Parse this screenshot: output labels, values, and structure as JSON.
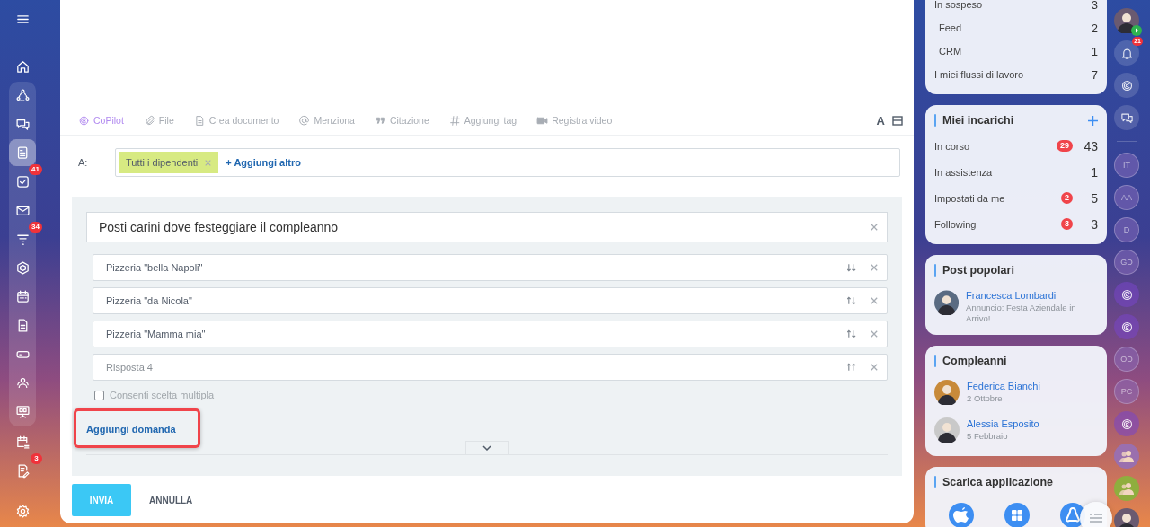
{
  "nav": {
    "items": [
      {
        "kind": "home",
        "grouped": false,
        "selected": false
      },
      {
        "kind": "network",
        "grouped": true,
        "selected": false
      },
      {
        "kind": "chat",
        "grouped": true,
        "selected": false
      },
      {
        "kind": "feed",
        "grouped": true,
        "selected": true
      },
      {
        "kind": "tasks",
        "grouped": true,
        "selected": false,
        "badge": "41"
      },
      {
        "kind": "mail",
        "grouped": true,
        "selected": false
      },
      {
        "kind": "funnel",
        "grouped": true,
        "selected": false,
        "badge": "34"
      },
      {
        "kind": "hexagon",
        "grouped": true,
        "selected": false
      },
      {
        "kind": "calendar",
        "grouped": true,
        "selected": false
      },
      {
        "kind": "document",
        "grouped": true,
        "selected": false
      },
      {
        "kind": "drive",
        "grouped": true,
        "selected": false
      },
      {
        "kind": "people",
        "grouped": true,
        "selected": false
      },
      {
        "kind": "presentation",
        "grouped": true,
        "selected": false
      },
      {
        "kind": "schedule",
        "grouped": false,
        "selected": false
      },
      {
        "kind": "edit",
        "grouped": false,
        "selected": false,
        "badge": "3"
      },
      {
        "kind": "settings",
        "grouped": false,
        "selected": false
      }
    ]
  },
  "composer": {
    "toolbar": [
      {
        "kind": "copilot",
        "label": "CoPilot",
        "accent": true
      },
      {
        "kind": "file",
        "label": "File",
        "accent": false
      },
      {
        "kind": "document",
        "label": "Crea documento",
        "accent": false
      },
      {
        "kind": "mention",
        "label": "Menziona",
        "accent": false
      },
      {
        "kind": "quote",
        "label": "Citazione",
        "accent": false
      },
      {
        "kind": "tag",
        "label": "Aggiungi tag",
        "accent": false
      },
      {
        "kind": "video",
        "label": "Registra video",
        "accent": false
      }
    ],
    "format_label": "A",
    "recipients": {
      "label": "A:",
      "tags": [
        {
          "label": "Tutti i dipendenti"
        }
      ],
      "add_link": "+ Aggiungi altro"
    },
    "poll": {
      "question": "Posti carini dove festeggiare il compleanno",
      "answers": [
        {
          "value": "Pizzeria \"bella Napoli\"",
          "kind": "down"
        },
        {
          "value": "Pizzeria \"da Nicola\"",
          "kind": "both"
        },
        {
          "value": "Pizzeria \"Mamma mia\"",
          "kind": "both"
        },
        {
          "placeholder": "Risposta  4",
          "kind": "up"
        }
      ],
      "multiple_choice": {
        "label": "Consenti scelta multipla",
        "checked": false
      },
      "add_question": {
        "label": "Aggiungi domanda",
        "highlighted": true
      }
    },
    "buttons": [
      {
        "label": "INVIA",
        "kind": "primary"
      },
      {
        "label": "ANNULLA",
        "kind": "plain"
      }
    ]
  },
  "right_panel": {
    "workflows": {
      "rows": [
        {
          "label": "In sospeso",
          "count": "3",
          "children": [
            {
              "label": "Feed",
              "count": "2"
            },
            {
              "label": "CRM",
              "count": "1"
            }
          ]
        },
        {
          "label": "I miei flussi di lavoro",
          "count": "7"
        }
      ]
    },
    "tasks": {
      "title": "Miei incarichi",
      "rows": [
        {
          "label": "In corso",
          "badge": "29",
          "count": "43"
        },
        {
          "label": "In assistenza",
          "count": "1"
        },
        {
          "label": "Impostati da me",
          "badge": "2",
          "count": "5"
        },
        {
          "label": "Following",
          "badge": "3",
          "count": "3"
        }
      ]
    },
    "popular": {
      "title": "Post popolari",
      "posts": [
        {
          "author": "Francesca Lombardi",
          "text": "Annuncio: Festa Aziendale in Arrivo!"
        }
      ]
    },
    "birthdays": {
      "title": "Compleanni",
      "people": [
        {
          "name": "Federica Bianchi",
          "date": "2 Ottobre"
        },
        {
          "name": "Alessia Esposito",
          "date": "5 Febbraio"
        }
      ]
    },
    "apps": {
      "title": "Scarica applicazione",
      "platforms": [
        {
          "kind": "apple"
        },
        {
          "kind": "windows"
        },
        {
          "kind": "linux"
        }
      ]
    }
  },
  "right_rail": {
    "items": [
      {
        "kind": "avatar"
      },
      {
        "kind": "bell",
        "badge": "21"
      },
      {
        "kind": "copilot"
      },
      {
        "kind": "chat"
      },
      {
        "kind": "divider"
      },
      {
        "kind": "initials",
        "text": "IT"
      },
      {
        "kind": "initials",
        "text": "AA"
      },
      {
        "kind": "initials",
        "text": "D"
      },
      {
        "kind": "initials",
        "text": "GD"
      },
      {
        "kind": "copilot-chat"
      },
      {
        "kind": "copilot-chat"
      },
      {
        "kind": "initials",
        "text": "OD"
      },
      {
        "kind": "initials",
        "text": "PC"
      },
      {
        "kind": "copilot-chat"
      },
      {
        "kind": "group",
        "color": "#9a6fae"
      },
      {
        "kind": "group",
        "color": "#8fae3e"
      },
      {
        "kind": "avatar"
      }
    ]
  }
}
